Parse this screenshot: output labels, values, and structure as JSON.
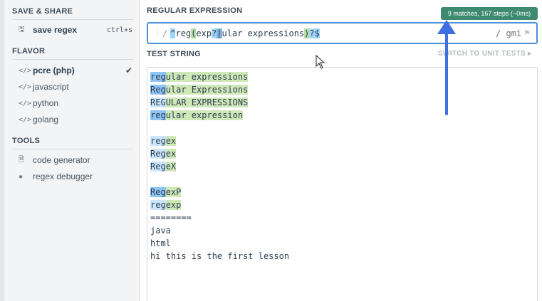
{
  "sidebar": {
    "save_share": {
      "heading": "SAVE & SHARE",
      "save_label": "save regex",
      "save_shortcut": "ctrl+s"
    },
    "flavor": {
      "heading": "FLAVOR",
      "items": [
        {
          "label": "pcre (php)",
          "selected": true
        },
        {
          "label": "javascript"
        },
        {
          "label": "python"
        },
        {
          "label": "golang"
        }
      ]
    },
    "tools": {
      "heading": "TOOLS",
      "items": [
        {
          "label": "code generator",
          "icon": "document-icon"
        },
        {
          "label": "regex debugger",
          "icon": "bug-icon"
        }
      ]
    }
  },
  "regex": {
    "heading": "REGULAR EXPRESSION",
    "match_info": "9 matches, 167 steps (~0ms)",
    "delimiter": "/",
    "tokens": [
      "^",
      "reg",
      "(",
      "exp",
      "?",
      "|",
      "ular expressions",
      ")",
      "?",
      "$"
    ],
    "flags": "/ gmi"
  },
  "test_string": {
    "heading": "TEST STRING",
    "switch_label": "SWITCH TO UNIT TESTS",
    "lines": [
      [
        {
          "t": "reg",
          "c": "m-blue"
        },
        {
          "t": "ular expressions",
          "c": "m-green"
        }
      ],
      [
        {
          "t": "Reg",
          "c": "m-blue"
        },
        {
          "t": "ular Expressions",
          "c": "m-green"
        }
      ],
      [
        {
          "t": "REG",
          "c": "m-light"
        },
        {
          "t": "ULAR EXPRESSIONS",
          "c": "m-green"
        }
      ],
      [
        {
          "t": "reg",
          "c": "m-blue"
        },
        {
          "t": "ular expression",
          "c": "m-green"
        }
      ],
      [
        {
          "t": "",
          "c": ""
        }
      ],
      [
        {
          "t": "reg",
          "c": "m-light"
        },
        {
          "t": "ex",
          "c": "m-green"
        }
      ],
      [
        {
          "t": "Reg",
          "c": "m-light"
        },
        {
          "t": "ex",
          "c": "m-green"
        }
      ],
      [
        {
          "t": "Reg",
          "c": "m-light"
        },
        {
          "t": "eX",
          "c": "m-green"
        }
      ],
      [
        {
          "t": "",
          "c": ""
        }
      ],
      [
        {
          "t": "Reg",
          "c": "m-blue"
        },
        {
          "t": "exP",
          "c": "m-green"
        }
      ],
      [
        {
          "t": "reg",
          "c": "m-light"
        },
        {
          "t": "exp",
          "c": "m-green"
        }
      ],
      [
        {
          "t": "========",
          "c": ""
        }
      ],
      [
        {
          "t": "java",
          "c": ""
        }
      ],
      [
        {
          "t": "html",
          "c": ""
        }
      ],
      [
        {
          "t": "hi this is the first lesson",
          "c": ""
        }
      ]
    ]
  },
  "colors": {
    "accent": "#4a90d9",
    "badge": "#3e8a71",
    "arrow": "#3f6fe0",
    "match_blue": "#8fc5f5",
    "match_green": "#cfe8b8"
  }
}
